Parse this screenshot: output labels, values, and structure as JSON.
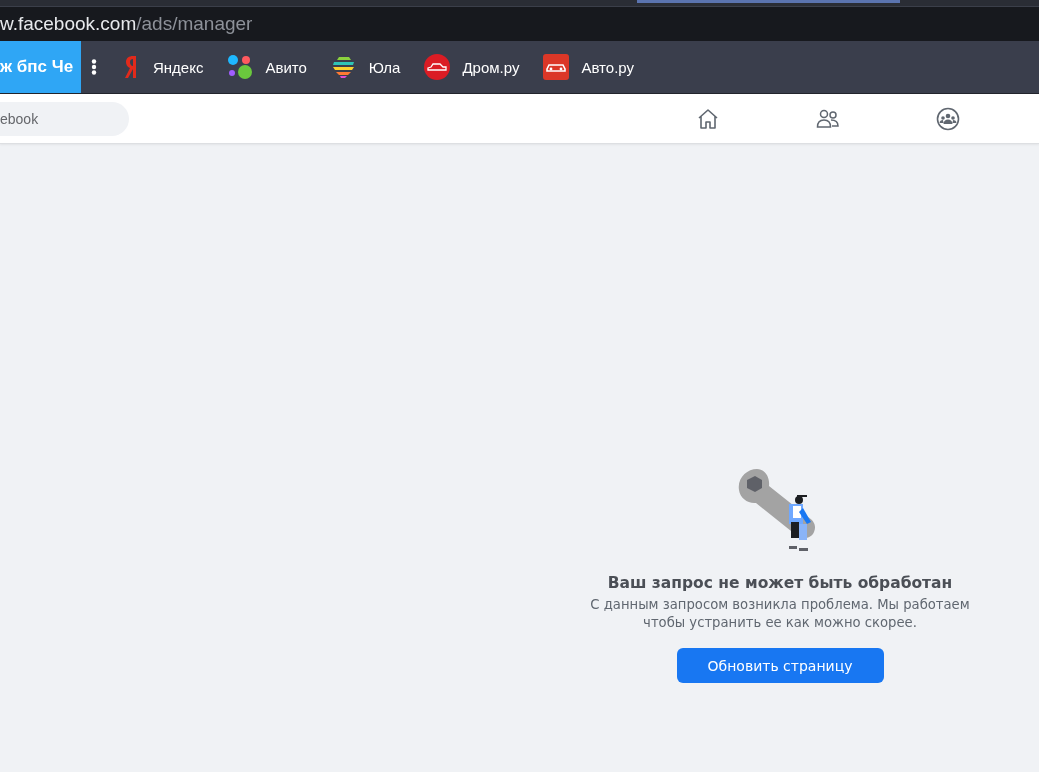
{
  "address_bar": {
    "host": "w.facebook.com",
    "path": "/ads/manager"
  },
  "bookmarks_bar": {
    "pinned": "ж бпс Че",
    "bookmarks": [
      {
        "label": "Яндекс",
        "kind": "yandex"
      },
      {
        "label": "Авито",
        "kind": "avito"
      },
      {
        "label": "Юла",
        "kind": "youla"
      },
      {
        "label": "Дром.ру",
        "kind": "drom"
      },
      {
        "label": "Авто.ру",
        "kind": "autoru"
      }
    ]
  },
  "header": {
    "search": {
      "placeholder": "ebook"
    },
    "nav": [
      {
        "kind": "home"
      },
      {
        "kind": "friends"
      },
      {
        "kind": "groups"
      }
    ]
  },
  "error": {
    "title": "Ваш запрос не может быть обработан",
    "message": "С данным запросом возникла проблема. Мы работаем чтобы устранить ее как можно скорее.",
    "button": "Обновить страницу"
  }
}
